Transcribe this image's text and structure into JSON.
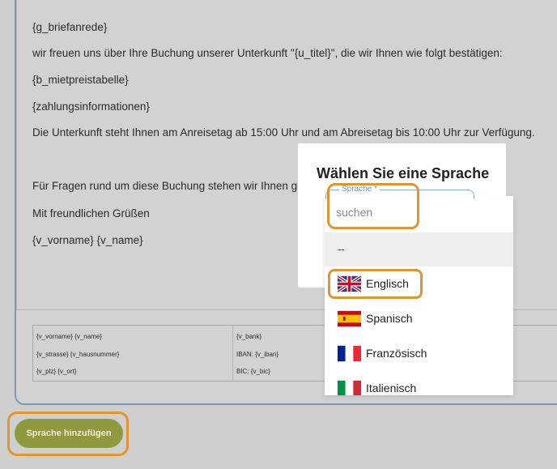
{
  "template": {
    "lines": [
      "{g_briefanrede}",
      "wir freuen uns über Ihre Buchung unserer Unterkunft \"{u_titel}\", die wir Ihnen wie folgt bestätigen:",
      "{b_mietpreistabelle}",
      "{zahlungsinformationen}",
      "Die Unterkunft steht Ihnen am Anreisetag ab 15:00 Uhr und am Abreisetag bis 10:00 Uhr zur Verfügung.",
      "Für Fragen rund um diese Buchung stehen wir Ihnen ge",
      "Mit freundlichen Grüßen",
      "{v_vorname} {v_name}"
    ],
    "footer": {
      "col1": [
        "{v_vorname} {v_name}",
        "{v_strasse} {v_hausnummer}",
        "{v_plz} {v_ort}"
      ],
      "col2": [
        "{v_bank}",
        "IBAN: {v_iban}",
        "BIC: {v_bic}"
      ]
    }
  },
  "add_language_button": "Sprache hinzufügen",
  "modal": {
    "title": "Wählen Sie eine Sprache",
    "field_label": "Sprache *",
    "search_placeholder": "suchen",
    "empty_option": "--",
    "options": [
      {
        "label": "Englisch",
        "flag": "uk-flag-icon"
      },
      {
        "label": "Spanisch",
        "flag": "spain-flag-icon"
      },
      {
        "label": "Französisch",
        "flag": "france-flag-icon"
      },
      {
        "label": "Italienisch",
        "flag": "italy-flag-icon"
      }
    ]
  },
  "colors": {
    "highlight": "#e0952e",
    "button": "#8f9a3e",
    "field_accent": "#5f9ad8"
  }
}
